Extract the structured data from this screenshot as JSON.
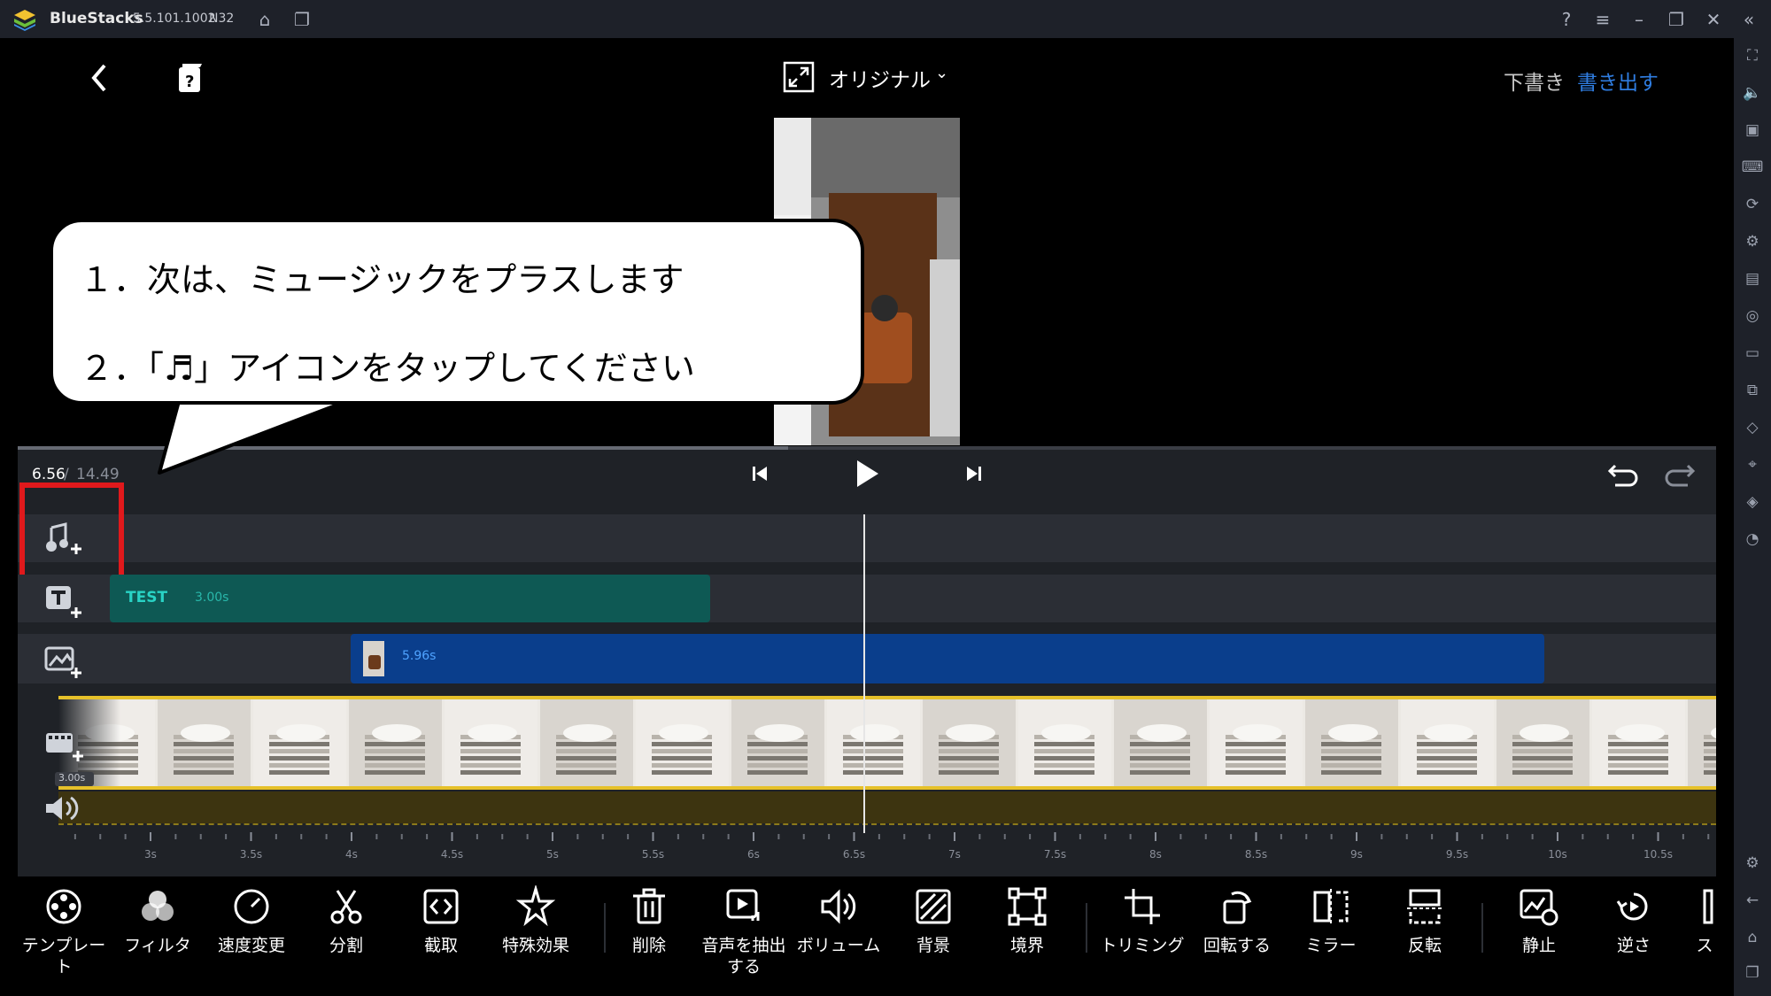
{
  "titlebar": {
    "app_name": "BlueStacks",
    "version": "5.5.101.1002",
    "build": "N32"
  },
  "topbar": {
    "aspect_label": "オリジナル",
    "draft_label": "下書き",
    "export_label": "書き出す"
  },
  "callout": {
    "line1": "１．次は、ミュージックをプラスします",
    "line2": "２．「♬」アイコンをタップしてください"
  },
  "player": {
    "current_time": "6.56",
    "separator": " / ",
    "total_time": "14.49"
  },
  "tracks": {
    "text_clip": {
      "label": "TEST",
      "duration": "3.00s"
    },
    "image_clip": {
      "duration": "5.96s"
    },
    "video_duration": "3.00s"
  },
  "ruler": {
    "ticks": [
      "3s",
      "3.5s",
      "4s",
      "4.5s",
      "5s",
      "5.5s",
      "6s",
      "6.5s",
      "7s",
      "7.5s",
      "8s",
      "8.5s",
      "9s",
      "9.5s",
      "10s",
      "10.5s"
    ]
  },
  "toolbar": {
    "tools": [
      {
        "name": "template",
        "label": "テンプレート",
        "icon": "template-icon"
      },
      {
        "name": "filter",
        "label": "フィルタ",
        "icon": "filter-icon"
      },
      {
        "name": "speed",
        "label": "速度変更",
        "icon": "speed-icon"
      },
      {
        "name": "split",
        "label": "分割",
        "icon": "scissors-icon"
      },
      {
        "name": "cut",
        "label": "截取",
        "icon": "cut-icon"
      },
      {
        "name": "effects",
        "label": "特殊効果",
        "icon": "effects-icon"
      },
      {
        "name": "delete",
        "label": "削除",
        "icon": "trash-icon"
      },
      {
        "name": "extract-audio",
        "label": "音声を抽出する",
        "icon": "extract-audio-icon"
      },
      {
        "name": "volume",
        "label": "ボリューム",
        "icon": "volume-icon"
      },
      {
        "name": "background",
        "label": "背景",
        "icon": "background-icon"
      },
      {
        "name": "border",
        "label": "境界",
        "icon": "border-icon"
      },
      {
        "name": "trimming",
        "label": "トリミング",
        "icon": "crop-icon"
      },
      {
        "name": "rotate",
        "label": "回転する",
        "icon": "rotate-icon"
      },
      {
        "name": "mirror",
        "label": "ミラー",
        "icon": "mirror-icon"
      },
      {
        "name": "flip",
        "label": "反転",
        "icon": "flip-icon"
      },
      {
        "name": "freeze",
        "label": "静止",
        "icon": "freeze-icon"
      },
      {
        "name": "reverse",
        "label": "逆さ",
        "icon": "reverse-icon"
      },
      {
        "name": "more",
        "label": "ス",
        "icon": "more-icon"
      }
    ]
  },
  "colors": {
    "accent_blue": "#2f7de1",
    "text_clip": "#0e5954",
    "image_clip": "#0a3e8c",
    "video_border": "#e6c12a",
    "highlight_red": "#e0191c"
  }
}
